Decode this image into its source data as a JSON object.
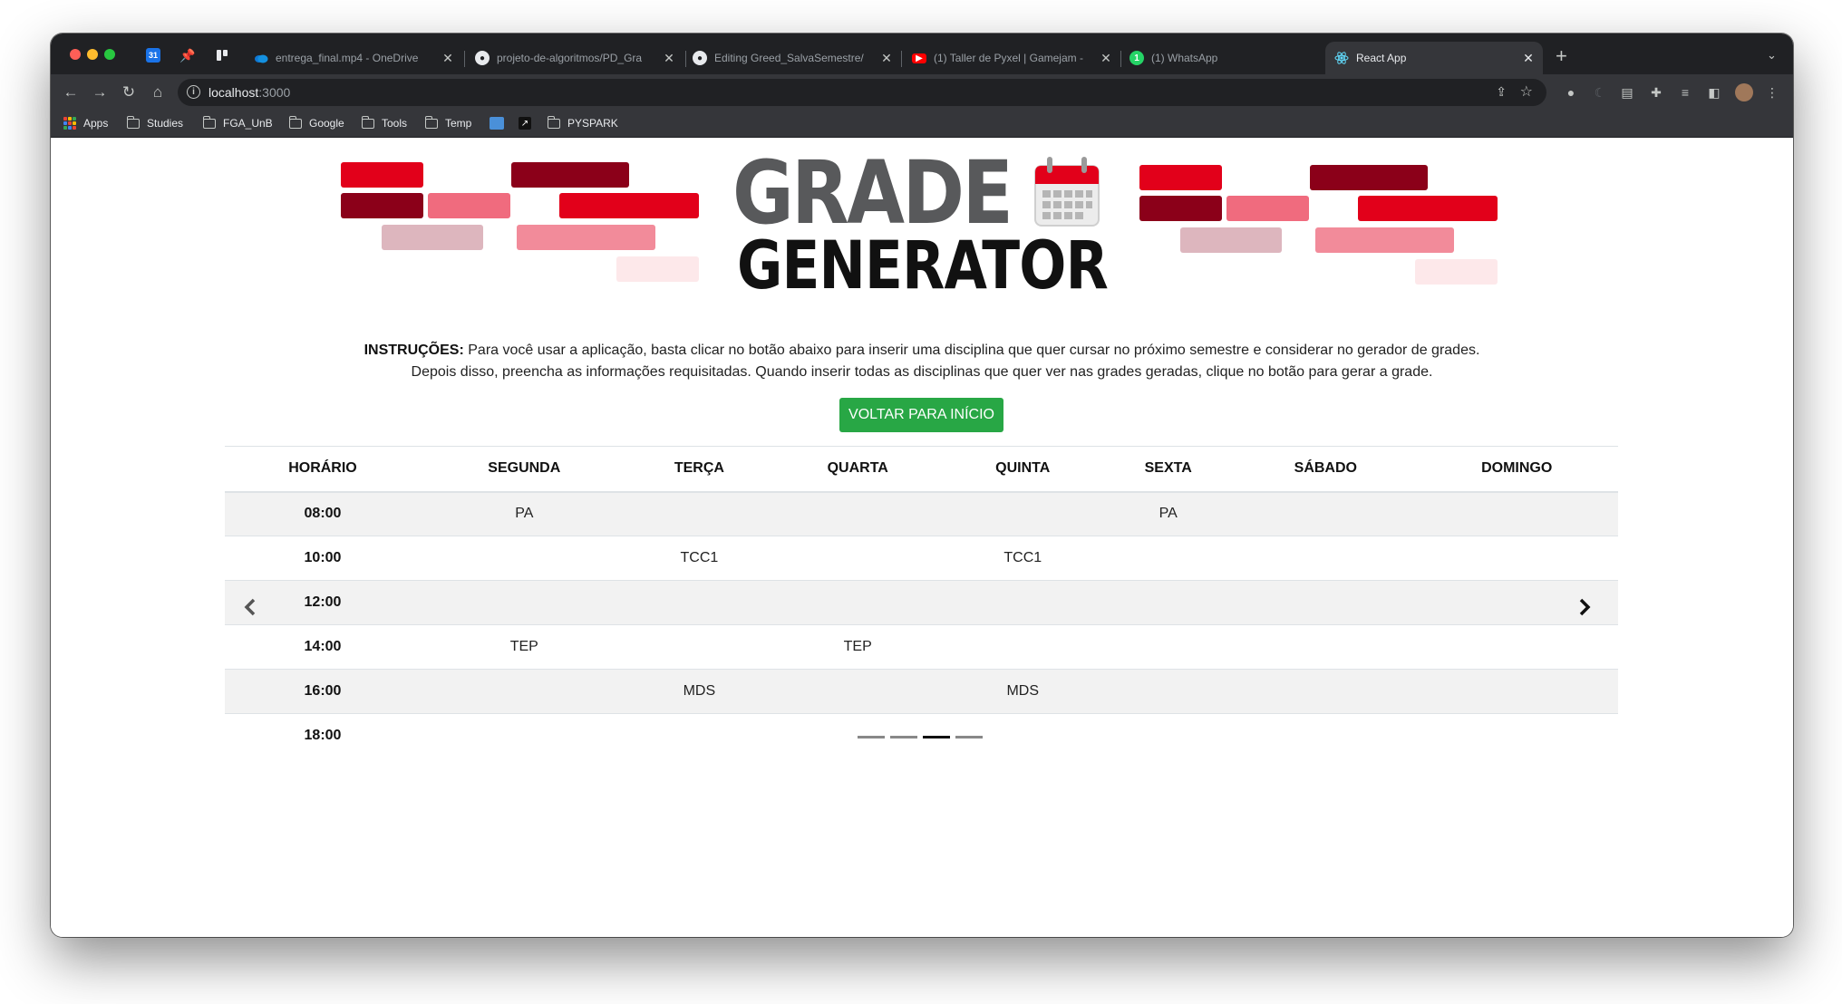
{
  "browser": {
    "tabs": [
      {
        "title": "entrega_final.mp4 - OneDrive",
        "favicon": "onedrive-icon"
      },
      {
        "title": "projeto-de-algoritmos/PD_Gra",
        "favicon": "github-icon"
      },
      {
        "title": "Editing Greed_SalvaSemestre/",
        "favicon": "github-icon"
      },
      {
        "title": "(1) Taller de Pyxel | Gamejam -",
        "favicon": "youtube-icon"
      },
      {
        "title": "(1) WhatsApp",
        "favicon": "whatsapp-icon"
      },
      {
        "title": "React App",
        "favicon": "react-icon"
      }
    ],
    "url_host": "localhost",
    "url_port": ":3000",
    "bookmarks": [
      "Apps",
      "Studies",
      "FGA_UnB",
      "Google",
      "Tools",
      "Temp",
      "PYSPARK"
    ]
  },
  "logo": {
    "line1": "GRADE",
    "line2": "GENERATOR"
  },
  "instructions": {
    "label": "INSTRUÇÕES:",
    "line1": "Para você usar a aplicação, basta clicar no botão abaixo para inserir uma disciplina que quer cursar no próximo semestre e considerar no gerador de grades.",
    "line2": "Depois disso, preencha as informações requisitadas. Quando inserir todas as disciplinas que quer ver nas grades geradas, clique no botão para gerar a grade."
  },
  "back_button": "VOLTAR PARA INÍCIO",
  "schedule": {
    "headers": [
      "HORÁRIO",
      "SEGUNDA",
      "TERÇA",
      "QUARTA",
      "QUINTA",
      "SEXTA",
      "SÁBADO",
      "DOMINGO"
    ],
    "rows": [
      [
        "08:00",
        "PA",
        "",
        "",
        "",
        "PA",
        "",
        ""
      ],
      [
        "10:00",
        "",
        "TCC1",
        "",
        "TCC1",
        "",
        "",
        ""
      ],
      [
        "12:00",
        "",
        "",
        "",
        "",
        "",
        "",
        ""
      ],
      [
        "14:00",
        "TEP",
        "",
        "TEP",
        "",
        "",
        "",
        ""
      ],
      [
        "16:00",
        "",
        "MDS",
        "",
        "MDS",
        "",
        "",
        ""
      ],
      [
        "18:00",
        "",
        "",
        "",
        "",
        "",
        "",
        ""
      ]
    ]
  },
  "carousel": {
    "slides": 4,
    "active_index": 2
  },
  "colors": {
    "accent_green": "#28a745",
    "brand_red": "#e2001a",
    "brand_dark_red": "#8b0019",
    "brand_pink": "#f06b7e",
    "brand_light_pink": "#f28b9a",
    "brand_pale_pink": "#ddb6be",
    "brand_faint_pink": "#fde8ea"
  }
}
